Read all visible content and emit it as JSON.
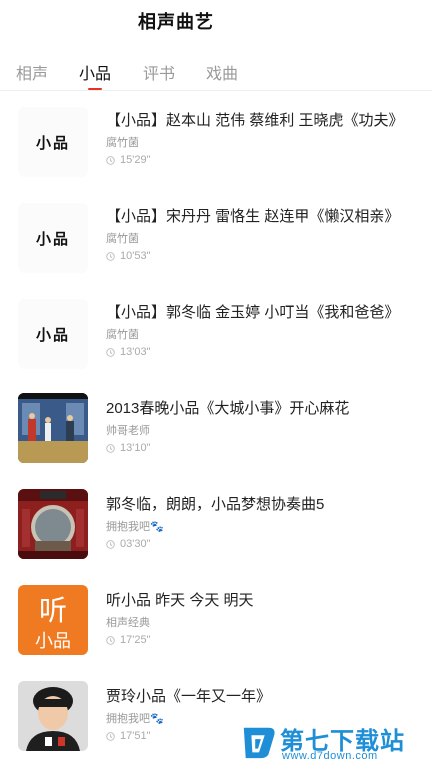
{
  "header": {
    "title": "相声曲艺"
  },
  "tabs": [
    {
      "label": "相声",
      "active": false
    },
    {
      "label": "小品",
      "active": true
    },
    {
      "label": "评书",
      "active": false
    },
    {
      "label": "戏曲",
      "active": false
    }
  ],
  "colors": {
    "accent": "#e5312b",
    "watermark": "#1e8fd6"
  },
  "items": [
    {
      "title": "【小品】赵本山 范伟 蔡维利 王晓虎《功夫》",
      "author": "腐竹菌",
      "duration": "15'29\"",
      "thumb_text": "小品"
    },
    {
      "title": "【小品】宋丹丹 雷恪生 赵连甲《懒汉相亲》",
      "author": "腐竹菌",
      "duration": "10'53\"",
      "thumb_text": "小品"
    },
    {
      "title": "【小品】郭冬临 金玉婷 小叮当《我和爸爸》",
      "author": "腐竹菌",
      "duration": "13'03\"",
      "thumb_text": "小品"
    },
    {
      "title": "2013春晚小品《大城小事》开心麻花",
      "author": "帅哥老师",
      "duration": "13'10\""
    },
    {
      "title": "郭冬临，朗朗，小品梦想协奏曲5",
      "author": "拥抱我吧🐾",
      "duration": "03'30\""
    },
    {
      "title": "听小品 昨天 今天 明天",
      "author": "相声经典",
      "duration": "17'25\"",
      "thumb_text_top": "听",
      "thumb_text_bottom": "小品"
    },
    {
      "title": "贾玲小品《一年又一年》",
      "author": "拥抱我吧🐾",
      "duration": "17'51\""
    }
  ],
  "watermark": {
    "name": "第七下载站",
    "url": "www.d7down.com",
    "icon": "d7-logo-icon"
  }
}
